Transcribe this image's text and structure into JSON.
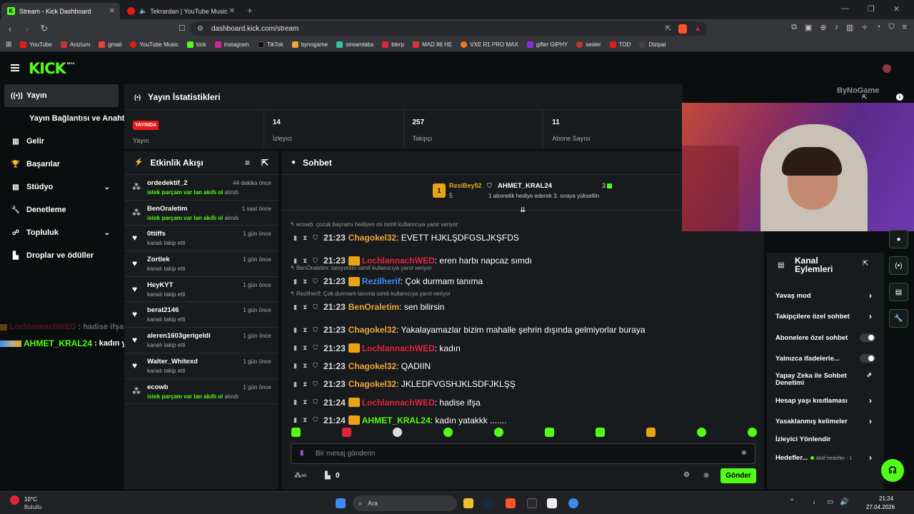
{
  "browser": {
    "tabs": [
      {
        "title": "Stream - Kick Dashboard",
        "active": true
      },
      {
        "title": "Tekrardan | YouTube Music",
        "active": false
      }
    ],
    "url": "dashboard.kick.com/stream",
    "bookmarks": [
      "YouTube",
      "Anizium",
      "gmail",
      "YouTube Music",
      "kick",
      "instagram",
      "TikTok",
      "bynogame",
      "streamlabs",
      "blerp",
      "MAD 86 HE",
      "VXE R1 PRO MAX",
      "gifler GIPHY",
      "sesler",
      "TOD",
      "Dizipal"
    ]
  },
  "brand": {
    "logo": "KICK",
    "beta": "BETA",
    "accent": "#53fc18"
  },
  "sidebar": {
    "items": [
      {
        "label": "Yayın",
        "icon": "broadcast-icon"
      },
      {
        "label": "Yayın Bağlantısı ve Anahtarı"
      },
      {
        "label": "Gelir",
        "icon": "chart-icon"
      },
      {
        "label": "Başarılar",
        "icon": "trophy-icon"
      },
      {
        "label": "Stüdyo",
        "icon": "studio-icon"
      },
      {
        "label": "Denetleme",
        "icon": "wrench-icon"
      },
      {
        "label": "Topluluk",
        "icon": "community-icon"
      },
      {
        "label": "Droplar ve ödüller",
        "icon": "drops-icon"
      }
    ]
  },
  "overlay_chat": [
    {
      "user": "LochlannachWED",
      "text": ": hadise ifşa"
    },
    {
      "user": "AHMET_KRAL24",
      "text": ": kadın yatakkk ......."
    }
  ],
  "stats": {
    "title": "Yayın İstatistikleri",
    "live_badge": "YAYINDA",
    "items": [
      {
        "value": "",
        "label": "Yayın"
      },
      {
        "value": "14",
        "label": "İzleyici"
      },
      {
        "value": "257",
        "label": "Takipçi"
      },
      {
        "value": "11",
        "label": "Abone Sayısı"
      }
    ]
  },
  "activity": {
    "title": "Etkinlik Akışı",
    "items": [
      {
        "name": "ordedektif_2",
        "sub_green": "istek parçam var lan akıllı ol",
        "sub": " alındı",
        "time": "44 dakika önce"
      },
      {
        "name": "BenOraletim",
        "sub_green": "istek parçam var lan akıllı ol",
        "sub": " alındı",
        "time": "1 saat önce"
      },
      {
        "name": "0ttiffs",
        "sub_green": "",
        "sub": "kanalı takip etti",
        "time": "1 gün önce"
      },
      {
        "name": "Zortlek",
        "sub_green": "",
        "sub": "kanalı takip etti",
        "time": "1 gün önce"
      },
      {
        "name": "HeyKYT",
        "sub_green": "",
        "sub": "kanalı takip etti",
        "time": "1 gün önce"
      },
      {
        "name": "berat2146",
        "sub_green": "",
        "sub": "kanalı takip etti",
        "time": "1 gün önce"
      },
      {
        "name": "aleren1603gerigeldi",
        "sub_green": "",
        "sub": "kanalı takip etti",
        "time": "1 gün önce"
      },
      {
        "name": "Walter_Whitexd",
        "sub_green": "",
        "sub": "kanalı takip etti",
        "time": "1 gün önce"
      },
      {
        "name": "ecowb",
        "sub_green": "istek parçam var lan akıllı ol",
        "sub": " alındı",
        "time": "1 gün önce"
      }
    ]
  },
  "chat": {
    "title": "Sohbet",
    "pinned": {
      "leader_user": "ResiBey52",
      "leader_count": "5",
      "top_user": "AHMET_KRAL24",
      "top_count": "3",
      "top_note": "1 abonelik hediye ederek 3. sıraya yükseltin"
    },
    "messages": [
      {
        "reply": "ecowb: çocuk bayramı hediyen mi isimli kullanıcıya yanıt veriyor",
        "time": "21:23",
        "user": "Chagokel32",
        "color": "#f0a43a",
        "badge": "",
        "text": ": EVETT HJKLŞDFGSLJKŞFDS"
      },
      {
        "reply": "",
        "time": "21:23",
        "user": "LochlannachWED",
        "color": "#e0243c",
        "badge": "crown",
        "text": ": eren harbı napcaz sımdı"
      },
      {
        "reply": "BenOraletim: tanıyımmı isimli kullanıcıya yanıt veriyor",
        "time": "21:23",
        "user": "Rezilherif",
        "color": "#3a8cf0",
        "badge": "crown",
        "text": ": Çok durmam tanıma"
      },
      {
        "reply": "Rezilherif: Çok durmam tanıma isimli kullanıcıya yanıt veriyor",
        "time": "21:23",
        "user": "BenOraletim",
        "color": "#f0a43a",
        "badge": "",
        "text": ": sen bilirsin"
      },
      {
        "reply": "",
        "time": "21:23",
        "user": "Chagokel32",
        "color": "#f0a43a",
        "badge": "",
        "text": ": Yakalayamazlar bizim mahalle şehrin dışında gelmiyorlar buraya"
      },
      {
        "reply": "",
        "time": "21:23",
        "user": "LochlannachWED",
        "color": "#e0243c",
        "badge": "crown",
        "text": ": kadın"
      },
      {
        "reply": "",
        "time": "21:23",
        "user": "Chagokel32",
        "color": "#f0a43a",
        "badge": "",
        "text": ": QADIIN"
      },
      {
        "reply": "",
        "time": "21:23",
        "user": "Chagokel32",
        "color": "#f0a43a",
        "badge": "",
        "text": ": JKLEDFVGSHJKLSDFJKLŞŞ"
      },
      {
        "reply": "",
        "time": "21:24",
        "user": "LochlannachWED",
        "color": "#e0243c",
        "badge": "crown",
        "text": ": hadise ifşa"
      },
      {
        "reply": "",
        "time": "21:24",
        "user": "AHMET_KRAL24",
        "color": "#53fc18",
        "badge": "crown",
        "text": ": kadın yatakkk ......."
      }
    ],
    "input_placeholder": "Bir mesaj gönderin",
    "points": "0",
    "send_label": "Gönder"
  },
  "channel_actions": {
    "title": "Kanal Eylemleri",
    "items": [
      {
        "label": "Yavaş mod",
        "control": "arrow"
      },
      {
        "label": "Takipçilere özel sohbet",
        "control": "arrow"
      },
      {
        "label": "Abonelere özel sohbet",
        "control": "toggle"
      },
      {
        "label": "Yalnızca ifadelerle...",
        "control": "toggle"
      },
      {
        "label": "Yapay Zeka ile Sohbet Denetimi",
        "control": "external"
      },
      {
        "label": "Hesap yaşı kısıtlaması",
        "control": "arrow"
      },
      {
        "label": "Yasaklanmış kelimeler",
        "control": "arrow"
      },
      {
        "label": "İzleyici Yönlendir",
        "control": "none"
      },
      {
        "label": "Hedefler...",
        "control": "arrow",
        "note": "Aktif hedefler - 1"
      }
    ]
  },
  "webcam": {
    "watermark": "ByNoGame"
  },
  "taskbar": {
    "weather_temp": "10°C",
    "weather_desc": "Bulutlu",
    "search": "Ara",
    "time": "21:24",
    "date": "27.04.2026"
  }
}
